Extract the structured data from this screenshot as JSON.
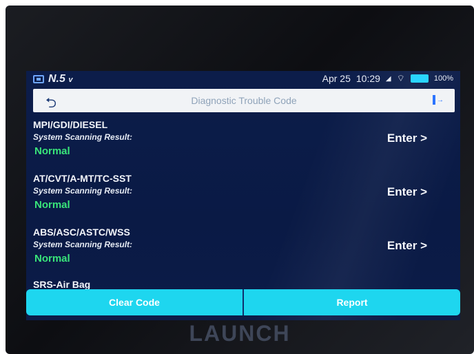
{
  "statusbar": {
    "voltage": "N.5",
    "voltage_unit": "v",
    "date": "Apr 25",
    "time": "10:29",
    "battery": "100%",
    "icons": [
      "vci-connection-icon",
      "signal-icon",
      "wifi-icon",
      "battery-icon"
    ]
  },
  "titlebar": {
    "title": "Diagnostic Trouble Code",
    "back_icon": "back-arrow-icon",
    "exit_icon": "exit-icon"
  },
  "systems": [
    {
      "name": "MPI/GDI/DIESEL",
      "label": "System Scanning Result:",
      "status": "Normal",
      "action": "Enter >"
    },
    {
      "name": "AT/CVT/A-MT/TC-SST",
      "label": "System Scanning Result:",
      "status": "Normal",
      "action": "Enter >"
    },
    {
      "name": "ABS/ASC/ASTC/WSS",
      "label": "System Scanning Result:",
      "status": "Normal",
      "action": "Enter >"
    },
    {
      "name": "SRS-Air Bag"
    }
  ],
  "actions": {
    "clear_code": "Clear Code",
    "report": "Report"
  },
  "brand": "LAUNCH",
  "colors": {
    "screen_bg": "#0a1a45",
    "status_ok": "#39e57a",
    "button": "#1ed6ef",
    "accent": "#2c74ff"
  }
}
